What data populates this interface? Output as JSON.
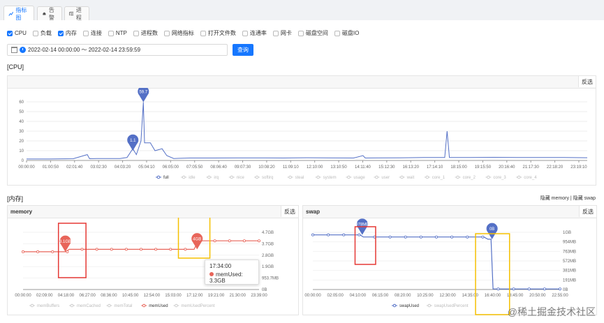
{
  "tabs": [
    {
      "label": "指标图",
      "active": true
    },
    {
      "label": "告警",
      "active": false
    },
    {
      "label": "进程",
      "active": false
    }
  ],
  "checkboxes": [
    {
      "label": "CPU",
      "checked": true
    },
    {
      "label": "负载",
      "checked": false
    },
    {
      "label": "内存",
      "checked": true
    },
    {
      "label": "连接",
      "checked": false
    },
    {
      "label": "NTP",
      "checked": false
    },
    {
      "label": "进程数",
      "checked": false
    },
    {
      "label": "网络指标",
      "checked": false
    },
    {
      "label": "打开文件数",
      "checked": false
    },
    {
      "label": "连通率",
      "checked": false
    },
    {
      "label": "网卡",
      "checked": false
    },
    {
      "label": "磁盘空间",
      "checked": false
    },
    {
      "label": "磁盘IO",
      "checked": false
    }
  ],
  "date_range": "2022-02-14 00:00:00 ～ 2022-02-14 23:59:59",
  "query_label": "查询",
  "sections": {
    "cpu": "[CPU]",
    "mem": "[内存]"
  },
  "fanxuan": "反选",
  "hide_links": {
    "memory": "隐藏 memory",
    "sep": "|",
    "swap": "隐藏 swap"
  },
  "tooltip": {
    "time": "17:34:00",
    "label": "memUsed: 3.3GB"
  },
  "watermark": "@稀土掘金技术社区",
  "colors": {
    "cpu": "#5470c6",
    "mem": "#e8655a",
    "swap": "#5470c6",
    "box": "#e53935",
    "box2": "#f5c000",
    "accent": "#1677ff"
  },
  "chart_data": [
    {
      "type": "line",
      "title": "",
      "ylim": [
        0,
        60
      ],
      "yticks": [
        "60",
        "50",
        "40",
        "30",
        "20",
        "10",
        "0"
      ],
      "xticks": [
        "00:00:00",
        "01:00:50",
        "02:01:40",
        "03:02:30",
        "04:03:20",
        "05:04:10",
        "06:05:00",
        "07:05:50",
        "08:06:40",
        "09:07:30",
        "10:08:20",
        "11:09:10",
        "12:10:00",
        "13:10:50",
        "14:11:40",
        "15:12:30",
        "16:13:20",
        "17:14:10",
        "18:15:00",
        "19:15:50",
        "20:16:40",
        "21:17:30",
        "22:18:20",
        "23:19:10"
      ],
      "legend": [
        "full",
        "idle",
        "irq",
        "nice",
        "softirq",
        "steal",
        "system",
        "usage",
        "user",
        "wait",
        "core_1",
        "core_2",
        "core_3",
        "core_4"
      ],
      "markers": [
        {
          "label": "59.7",
          "hour": 5.0,
          "y": 59.7
        },
        {
          "label": "1.1",
          "hour": 4.55,
          "y": 10
        }
      ],
      "series": [
        {
          "name": "full",
          "points": [
            [
              0,
              1.5
            ],
            [
              1,
              1.5
            ],
            [
              2,
              1.8
            ],
            [
              2.6,
              6
            ],
            [
              2.7,
              1.8
            ],
            [
              3,
              2
            ],
            [
              4,
              2
            ],
            [
              4.3,
              3
            ],
            [
              4.55,
              12
            ],
            [
              4.7,
              6
            ],
            [
              4.9,
              20
            ],
            [
              5,
              59.7
            ],
            [
              5.05,
              18
            ],
            [
              5.3,
              18
            ],
            [
              5.5,
              10
            ],
            [
              5.8,
              12
            ],
            [
              6,
              5
            ],
            [
              6.3,
              2
            ],
            [
              7,
              2.5
            ],
            [
              8,
              2.5
            ],
            [
              9,
              2.6
            ],
            [
              10,
              2.6
            ],
            [
              11,
              2.5
            ],
            [
              12,
              2.8
            ],
            [
              13,
              2.6
            ],
            [
              14,
              2.5
            ],
            [
              14.4,
              5
            ],
            [
              14.5,
              2.5
            ],
            [
              15,
              2.6
            ],
            [
              16,
              2.7
            ],
            [
              17,
              3
            ],
            [
              17.9,
              3
            ],
            [
              18,
              30
            ],
            [
              18.1,
              3
            ],
            [
              19,
              3
            ],
            [
              20,
              3.2
            ],
            [
              21,
              3
            ],
            [
              22,
              3
            ],
            [
              23,
              3.1
            ],
            [
              24,
              2.8
            ]
          ]
        }
      ]
    },
    {
      "type": "line",
      "title": "memory",
      "yticks": [
        "4.7GB",
        "3.7GB",
        "2.8GB",
        "1.9GB",
        "953.7MB",
        "0B"
      ],
      "ylim": [
        0,
        4.7
      ],
      "xticks": [
        "00:00:00",
        "02:09:00",
        "04:18:00",
        "06:27:00",
        "08:36:00",
        "10:45:00",
        "12:54:00",
        "15:03:00",
        "17:12:00",
        "19:21:00",
        "21:30:00",
        "23:39:00"
      ],
      "legend": [
        "memBuffers",
        "memCached",
        "memTotal",
        "memUsed",
        "memUsedPercent"
      ],
      "markers": [
        {
          "label": "3.1GB",
          "hour": 4.3
        },
        {
          "label": "4GB",
          "hour": 17.7
        }
      ],
      "series": [
        {
          "name": "memUsed",
          "points": [
            [
              0,
              3.1
            ],
            [
              4.3,
              3.1
            ],
            [
              4.7,
              3.3
            ],
            [
              17.4,
              3.3
            ],
            [
              17.8,
              4.0
            ],
            [
              24,
              4.0
            ]
          ]
        }
      ]
    },
    {
      "type": "line",
      "title": "swap",
      "yticks": [
        "1GB",
        "954MB",
        "763MB",
        "572MB",
        "381MB",
        "191MB",
        "0B"
      ],
      "ylim": [
        0,
        1024
      ],
      "xticks": [
        "00:00:00",
        "02:05:00",
        "04:10:00",
        "06:15:00",
        "08:20:00",
        "10:25:00",
        "12:30:00",
        "14:35:00",
        "16:40:00",
        "18:45:00",
        "20:50:00",
        "22:55:00"
      ],
      "legend": [
        "swapUsed",
        "swapUsedPercent"
      ],
      "markers": [
        {
          "label": "978MB",
          "hour": 4.8
        },
        {
          "label": "0B",
          "hour": 17.4
        }
      ],
      "series": [
        {
          "name": "swapUsed",
          "points": [
            [
              0,
              978
            ],
            [
              4.6,
              978
            ],
            [
              4.9,
              940
            ],
            [
              16.6,
              940
            ],
            [
              17.0,
              900
            ],
            [
              17.3,
              900
            ],
            [
              17.5,
              10
            ],
            [
              24,
              10
            ]
          ]
        }
      ]
    }
  ]
}
